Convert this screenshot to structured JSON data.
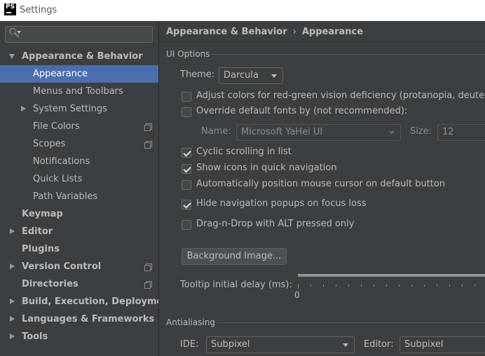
{
  "window": {
    "title": "Settings",
    "logo_text": "PS"
  },
  "search": {
    "placeholder": ""
  },
  "sidebar": {
    "items": [
      {
        "label": "Appearance & Behavior"
      },
      {
        "label": "Appearance"
      },
      {
        "label": "Menus and Toolbars"
      },
      {
        "label": "System Settings"
      },
      {
        "label": "File Colors"
      },
      {
        "label": "Scopes"
      },
      {
        "label": "Notifications"
      },
      {
        "label": "Quick Lists"
      },
      {
        "label": "Path Variables"
      },
      {
        "label": "Keymap"
      },
      {
        "label": "Editor"
      },
      {
        "label": "Plugins"
      },
      {
        "label": "Version Control"
      },
      {
        "label": "Directories"
      },
      {
        "label": "Build, Execution, Deployment"
      },
      {
        "label": "Languages & Frameworks"
      },
      {
        "label": "Tools"
      }
    ]
  },
  "breadcrumb": {
    "parent": "Appearance & Behavior",
    "separator": "›",
    "current": "Appearance"
  },
  "ui_options": {
    "section_title": "UI Options",
    "theme_label": "Theme:",
    "theme_value": "Darcula",
    "adjust_colors_label": "Adjust colors for red-green vision deficiency (protanopia, deuteranopia)",
    "adjust_colors_checked": false,
    "override_fonts_label": "Override default fonts by (not recommended):",
    "override_fonts_checked": false,
    "font_name_label": "Name:",
    "font_name_value": "Microsoft YaHei UI",
    "font_size_label": "Size:",
    "font_size_value": "12",
    "cyclic_scrolling_label": "Cyclic scrolling in list",
    "cyclic_scrolling_checked": true,
    "show_icons_label": "Show icons in quick navigation",
    "show_icons_checked": true,
    "auto_position_label": "Automatically position mouse cursor on default button",
    "auto_position_checked": false,
    "hide_popups_label": "Hide navigation popups on focus loss",
    "hide_popups_checked": true,
    "drag_drop_label": "Drag-n-Drop with ALT pressed only",
    "drag_drop_checked": false,
    "background_image_button": "Background Image...",
    "tooltip_delay_label": "Tooltip initial delay (ms):",
    "tooltip_delay_min": "0"
  },
  "antialiasing": {
    "section_title": "Antialiasing",
    "ide_label": "IDE:",
    "ide_value": "Subpixel",
    "editor_label": "Editor:",
    "editor_value": "Subpixel"
  },
  "colors": {
    "selection": "#4b6eaf",
    "background": "#3c3f41",
    "text": "#bbbbbb"
  }
}
